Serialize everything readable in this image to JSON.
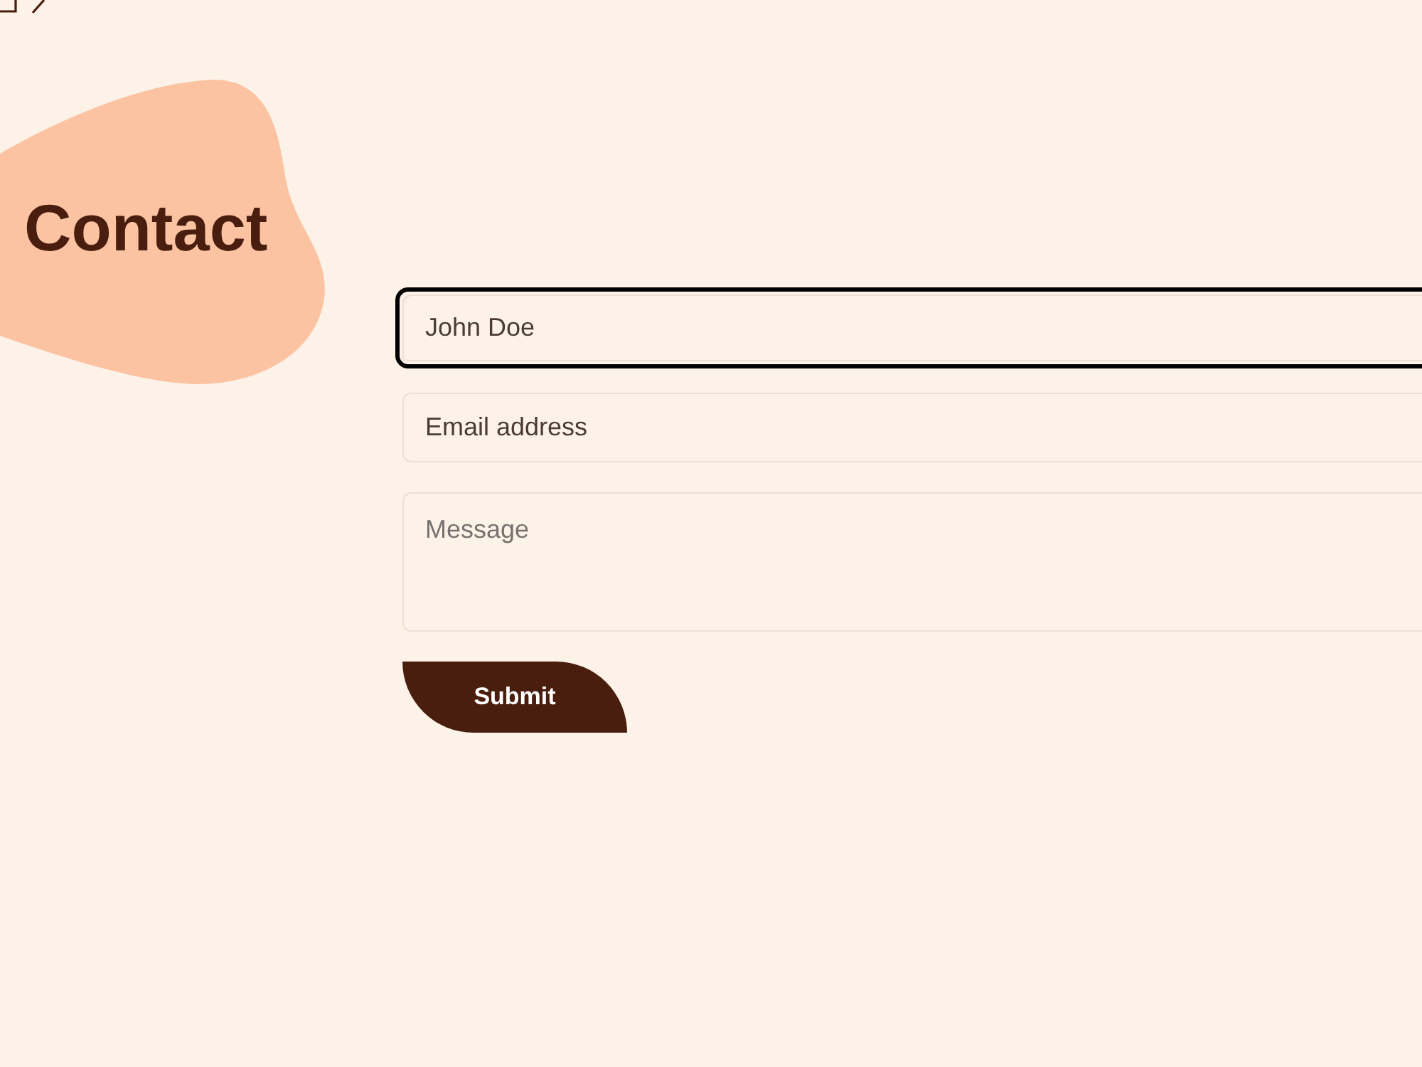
{
  "page": {
    "title": "Contact"
  },
  "form": {
    "fields": [
      {
        "kind": "input",
        "placeholder": "John Doe",
        "focused": true
      },
      {
        "kind": "input",
        "placeholder": "Email address",
        "focused": false
      },
      {
        "kind": "textarea",
        "placeholder": "Message",
        "focused": false
      }
    ],
    "submit": {
      "label": "Submit"
    }
  }
}
